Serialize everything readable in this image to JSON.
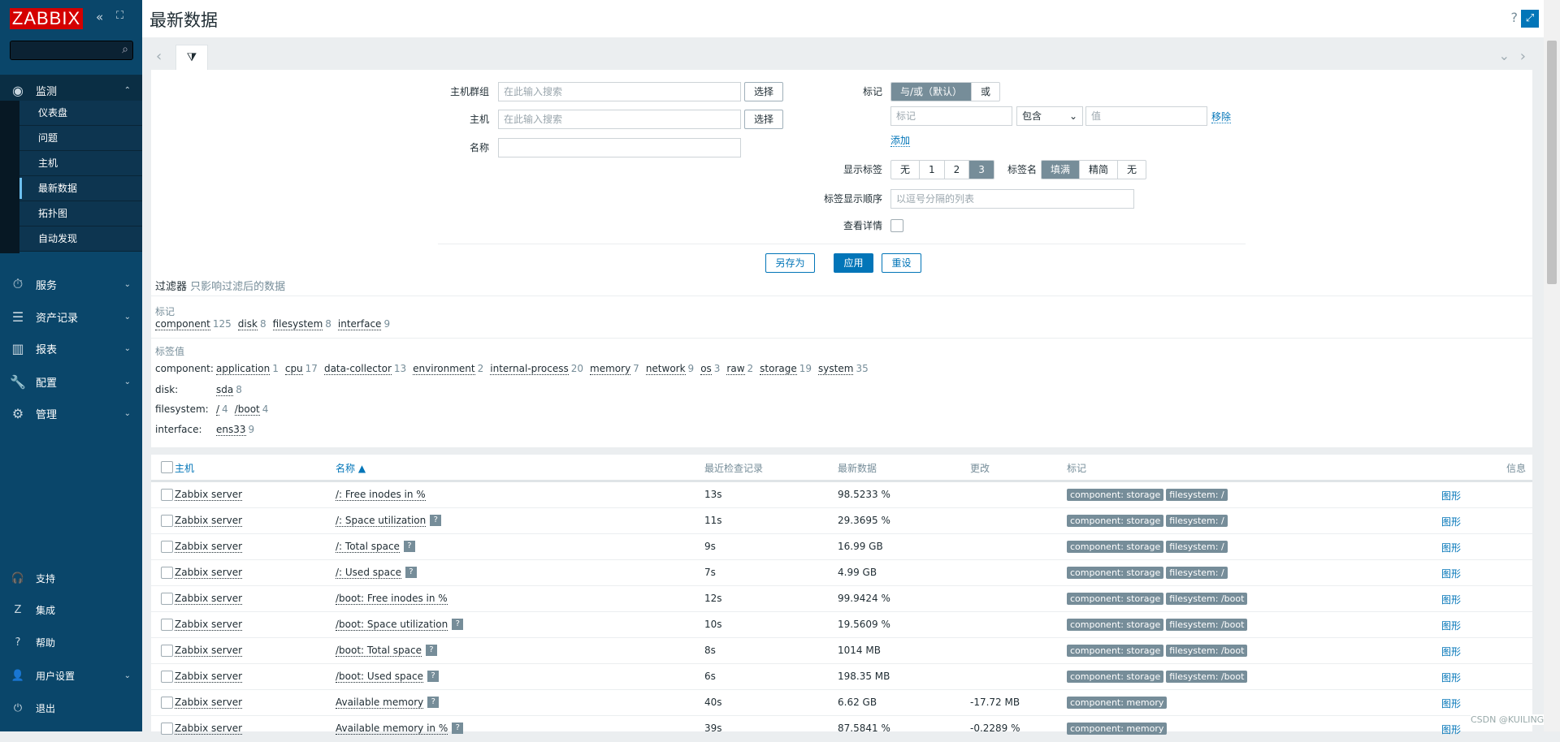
{
  "sidebar": {
    "logo": "ZABBIX",
    "search_placeholder": "",
    "menu": [
      {
        "label": "监测",
        "icon": "eye-icon",
        "expanded": true
      },
      {
        "label": "服务",
        "icon": "stopwatch-icon"
      },
      {
        "label": "资产记录",
        "icon": "list-icon"
      },
      {
        "label": "报表",
        "icon": "chart-icon"
      },
      {
        "label": "配置",
        "icon": "wrench-icon"
      },
      {
        "label": "管理",
        "icon": "gear-icon"
      }
    ],
    "submenu": [
      "仪表盘",
      "问题",
      "主机",
      "最新数据",
      "拓扑图",
      "自动发现"
    ],
    "active": "最新数据",
    "bottom": [
      {
        "label": "支持",
        "icon": "headset-icon"
      },
      {
        "label": "集成",
        "icon": "z-icon"
      },
      {
        "label": "帮助",
        "icon": "question-icon"
      },
      {
        "label": "用户设置",
        "icon": "user-icon"
      },
      {
        "label": "退出",
        "icon": "power-icon"
      }
    ]
  },
  "header": {
    "title": "最新数据",
    "help": "?"
  },
  "filter": {
    "host_groups_label": "主机群组",
    "host_groups_placeholder": "在此输入搜索",
    "select": "选择",
    "hosts_label": "主机",
    "hosts_placeholder": "在此输入搜索",
    "name_label": "名称",
    "name_value": "",
    "tags_label": "标记",
    "tag_mode": [
      "与/或（默认）",
      "或"
    ],
    "tag_placeholder": "标记",
    "operator": "包含",
    "value_placeholder": "值",
    "remove": "移除",
    "add": "添加",
    "show_tags_label": "显示标签",
    "show_tags": [
      "无",
      "1",
      "2",
      "3"
    ],
    "show_tags_selected": "3",
    "tag_name_label": "标签名",
    "tag_name": [
      "填满",
      "精简",
      "无"
    ],
    "tag_name_selected": "填满",
    "tag_priority_label": "标签显示顺序",
    "tag_priority_placeholder": "以逗号分隔的列表",
    "details_label": "查看详情",
    "details_checked": false,
    "save_as": "另存为",
    "apply": "应用",
    "reset": "重设"
  },
  "subfilter": {
    "title": "过滤器",
    "note": "只影响过滤后的数据",
    "tags_heading": "标记",
    "tags": [
      {
        "name": "component",
        "count": "125"
      },
      {
        "name": "disk",
        "count": "8"
      },
      {
        "name": "filesystem",
        "count": "8"
      },
      {
        "name": "interface",
        "count": "9"
      }
    ],
    "values_heading": "标签值",
    "values": [
      {
        "key": "component:",
        "items": [
          {
            "name": "application",
            "count": "1"
          },
          {
            "name": "cpu",
            "count": "17"
          },
          {
            "name": "data-collector",
            "count": "13"
          },
          {
            "name": "environment",
            "count": "2"
          },
          {
            "name": "internal-process",
            "count": "20"
          },
          {
            "name": "memory",
            "count": "7"
          },
          {
            "name": "network",
            "count": "9"
          },
          {
            "name": "os",
            "count": "3"
          },
          {
            "name": "raw",
            "count": "2"
          },
          {
            "name": "storage",
            "count": "19"
          },
          {
            "name": "system",
            "count": "35"
          }
        ]
      },
      {
        "key": "disk:",
        "items": [
          {
            "name": "sda",
            "count": "8"
          }
        ]
      },
      {
        "key": "filesystem:",
        "items": [
          {
            "name": "/",
            "count": "4"
          },
          {
            "name": "/boot",
            "count": "4"
          }
        ]
      },
      {
        "key": "interface:",
        "items": [
          {
            "name": "ens33",
            "count": "9"
          }
        ]
      }
    ]
  },
  "table": {
    "columns": [
      "主机",
      "名称 ▲",
      "最近检查记录",
      "最新数据",
      "更改",
      "标记",
      "信息"
    ],
    "rows": [
      {
        "host": "Zabbix server",
        "name": "/: Free inodes in %",
        "help": false,
        "last": "13s",
        "value": "98.5233 %",
        "change": "",
        "tags": [
          "component: storage",
          "filesystem: /"
        ],
        "graph": "图形"
      },
      {
        "host": "Zabbix server",
        "name": "/: Space utilization",
        "help": true,
        "last": "11s",
        "value": "29.3695 %",
        "change": "",
        "tags": [
          "component: storage",
          "filesystem: /"
        ],
        "graph": "图形"
      },
      {
        "host": "Zabbix server",
        "name": "/: Total space",
        "help": true,
        "last": "9s",
        "value": "16.99 GB",
        "change": "",
        "tags": [
          "component: storage",
          "filesystem: /"
        ],
        "graph": "图形"
      },
      {
        "host": "Zabbix server",
        "name": "/: Used space",
        "help": true,
        "last": "7s",
        "value": "4.99 GB",
        "change": "",
        "tags": [
          "component: storage",
          "filesystem: /"
        ],
        "graph": "图形"
      },
      {
        "host": "Zabbix server",
        "name": "/boot: Free inodes in %",
        "help": false,
        "last": "12s",
        "value": "99.9424 %",
        "change": "",
        "tags": [
          "component: storage",
          "filesystem: /boot"
        ],
        "graph": "图形"
      },
      {
        "host": "Zabbix server",
        "name": "/boot: Space utilization",
        "help": true,
        "last": "10s",
        "value": "19.5609 %",
        "change": "",
        "tags": [
          "component: storage",
          "filesystem: /boot"
        ],
        "graph": "图形"
      },
      {
        "host": "Zabbix server",
        "name": "/boot: Total space",
        "help": true,
        "last": "8s",
        "value": "1014 MB",
        "change": "",
        "tags": [
          "component: storage",
          "filesystem: /boot"
        ],
        "graph": "图形"
      },
      {
        "host": "Zabbix server",
        "name": "/boot: Used space",
        "help": true,
        "last": "6s",
        "value": "198.35 MB",
        "change": "",
        "tags": [
          "component: storage",
          "filesystem: /boot"
        ],
        "graph": "图形"
      },
      {
        "host": "Zabbix server",
        "name": "Available memory",
        "help": true,
        "last": "40s",
        "value": "6.62 GB",
        "change": "-17.72 MB",
        "tags": [
          "component: memory"
        ],
        "graph": "图形"
      },
      {
        "host": "Zabbix server",
        "name": "Available memory in %",
        "help": true,
        "last": "39s",
        "value": "87.5841 %",
        "change": "-0.2289 %",
        "tags": [
          "component: memory"
        ],
        "graph": "图形"
      }
    ]
  },
  "watermark": "CSDN @KUILING"
}
